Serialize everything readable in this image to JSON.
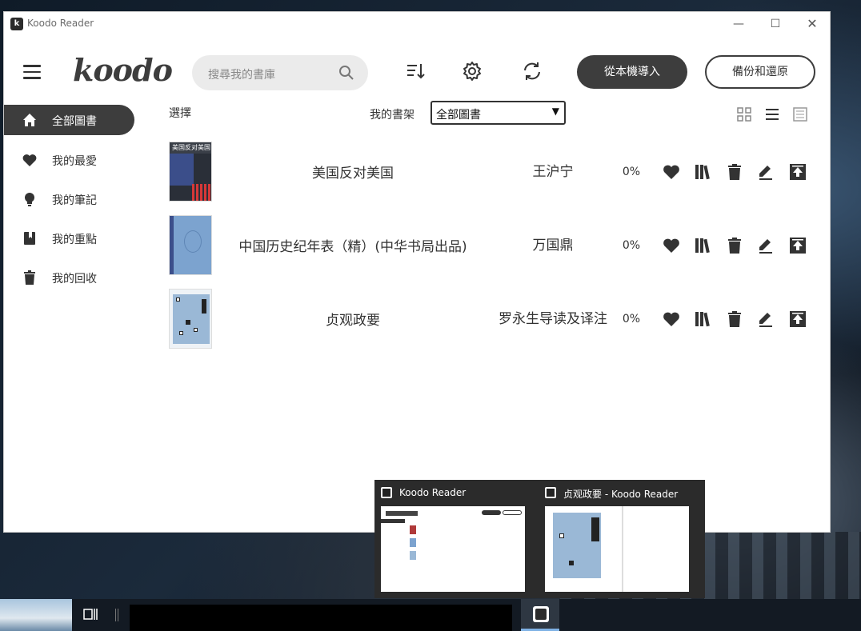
{
  "window": {
    "title": "Koodo Reader",
    "controls": {
      "minimize": "—",
      "maximize": "☐",
      "close": "✕"
    }
  },
  "header": {
    "logo": "koodo",
    "search_placeholder": "搜尋我的書庫",
    "import_button": "從本機導入",
    "backup_button": "備份和還原"
  },
  "sidebar": {
    "items": [
      {
        "label": "全部圖書",
        "icon": "home-icon",
        "active": true
      },
      {
        "label": "我的最愛",
        "icon": "heart-icon",
        "active": false
      },
      {
        "label": "我的筆記",
        "icon": "bulb-icon",
        "active": false
      },
      {
        "label": "我的重點",
        "icon": "bookmark-book-icon",
        "active": false
      },
      {
        "label": "我的回收",
        "icon": "trash-icon",
        "active": false
      }
    ]
  },
  "toolbar": {
    "select_label": "選擇",
    "shelf_label": "我的書架",
    "shelf_value": "全部圖書"
  },
  "books": [
    {
      "title": "美国反对美国",
      "author": "王沪宁",
      "progress": "0%",
      "cover_text": "美国反对美国"
    },
    {
      "title": "中国历史纪年表（精）(中华书局出品)",
      "author": "万国鼎",
      "progress": "0%",
      "cover_text": ""
    },
    {
      "title": "贞观政要",
      "author": "罗永生导读及译注",
      "progress": "0%",
      "cover_text": ""
    }
  ],
  "taskbar_preview": {
    "items": [
      {
        "title": "Koodo Reader"
      },
      {
        "title": "贞观政要 - Koodo Reader"
      }
    ]
  },
  "colors": {
    "accent": "#3d3d3d",
    "window_bg": "#ffffff",
    "search_bg": "#ebebeb"
  }
}
